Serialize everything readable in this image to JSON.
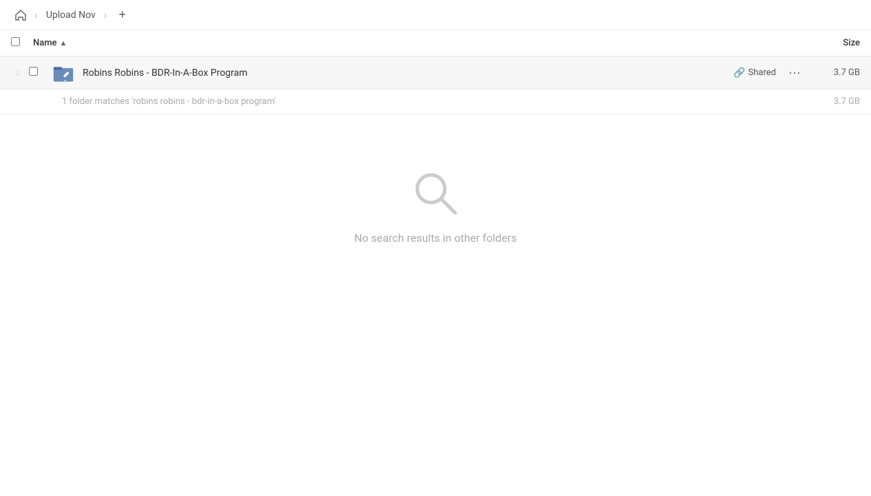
{
  "topbar": {
    "home_title": "Home",
    "breadcrumb_item": "Upload Nov",
    "add_label": "+"
  },
  "table": {
    "col_name_label": "Name",
    "col_size_label": "Size",
    "sort_direction": "asc"
  },
  "file_row": {
    "name": "Robins Robins - BDR-In-A-Box Program",
    "size": "3.7 GB",
    "shared_label": "Shared"
  },
  "match_info": {
    "text": "1 folder matches 'robins robins - bdr-in-a-box program'",
    "size": "3.7 GB"
  },
  "no_results": {
    "text": "No search results in other folders"
  }
}
